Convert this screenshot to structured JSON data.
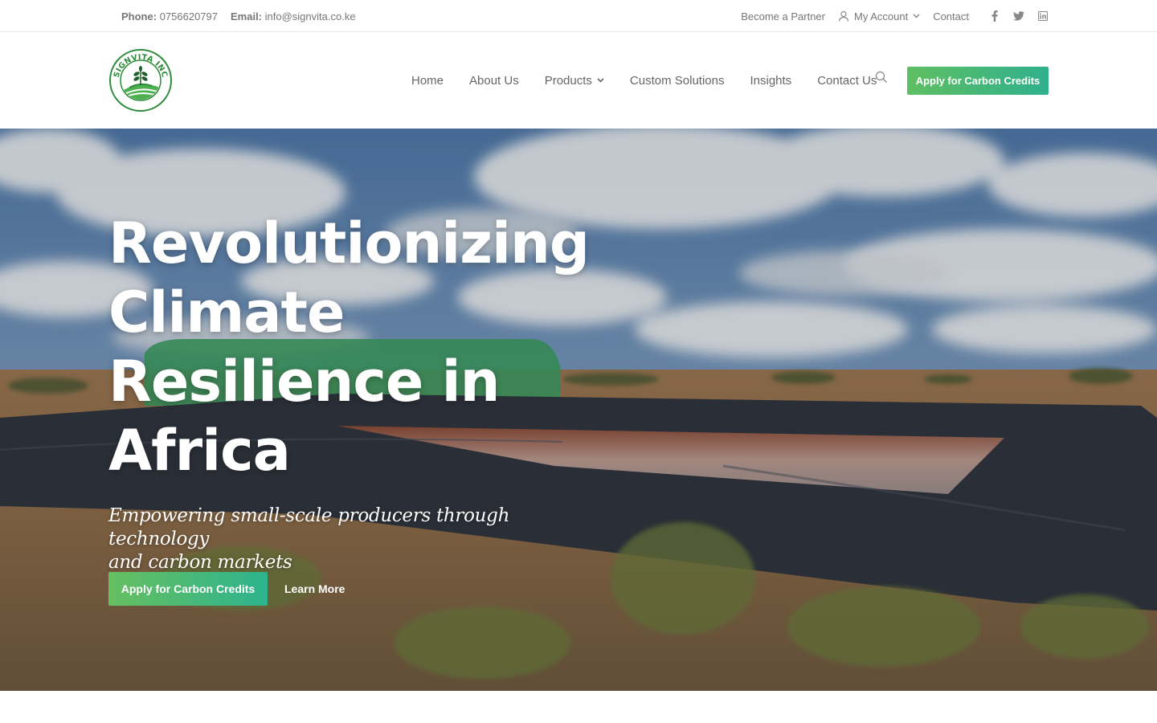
{
  "topbar": {
    "phone_label": "Phone:",
    "phone": "0756620797",
    "email_label": "Email:",
    "email": "info@signvita.co.ke",
    "links": {
      "partner": "Become a Partner",
      "account": "My Account",
      "contact": "Contact"
    },
    "social": [
      "facebook-icon",
      "twitter-icon",
      "linkedin-icon"
    ]
  },
  "header": {
    "logo_text": "SIGNVITA INC",
    "nav": {
      "home": "Home",
      "about": "About Us",
      "products": "Products",
      "custom": "Custom Solutions",
      "insights": "Insights",
      "contact": "Contact Us"
    },
    "cta": "Apply for Carbon Credits"
  },
  "hero": {
    "title_lines": [
      "Revolutionizing",
      "Climate",
      "Resilience in",
      "Africa"
    ],
    "subtitle_lines": [
      "Empowering small-scale producers through technology",
      "and carbon markets"
    ],
    "cta_primary": "Apply for Carbon Credits",
    "cta_secondary": "Learn More"
  },
  "colors": {
    "brand_green": "#5fbf63",
    "brand_teal": "#2fb08d",
    "logo_green": "#2e8b3a",
    "nav_text": "#666666"
  }
}
